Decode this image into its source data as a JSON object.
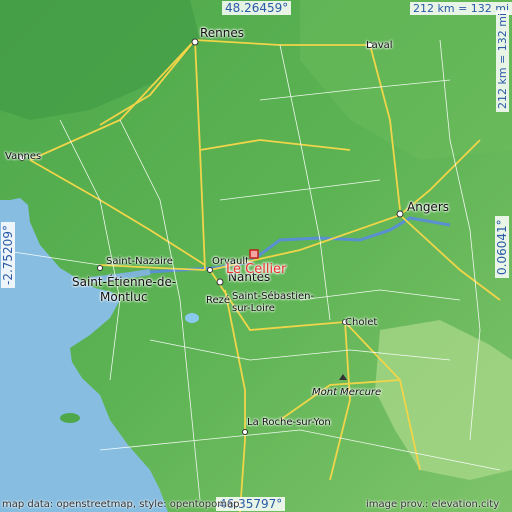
{
  "map": {
    "bounds": {
      "north": "48.26459°",
      "south": "46.35797°",
      "west": "-2.75209°",
      "east": "0.06041°"
    },
    "scale": {
      "horizontal": "212 km = 132 mi",
      "vertical": "212 km = 132 mi"
    },
    "featured_place": "Le Cellier",
    "places": {
      "rennes": "Rennes",
      "laval": "Laval",
      "vannes": "Vannes",
      "angers": "Angers",
      "saint_nazaire": "Saint-Nazaire",
      "saint_etienne_line1": "Saint-Étienne-de-",
      "saint_etienne_line2": "Montluc",
      "orvault": "Orvault",
      "nantes": "Nantes",
      "reze": "Rezé",
      "saint_sebastien_line1": "Saint-Sébastien-",
      "saint_sebastien_line2": "sur-Loire",
      "cholet": "Cholet",
      "mont_mercure": "Mont Mercure",
      "la_roche": "La Roche-sur-Yon"
    },
    "credits": {
      "left": "map data: openstreetmap, style: opentopomap",
      "right": "image prov.: elevation.city"
    }
  }
}
